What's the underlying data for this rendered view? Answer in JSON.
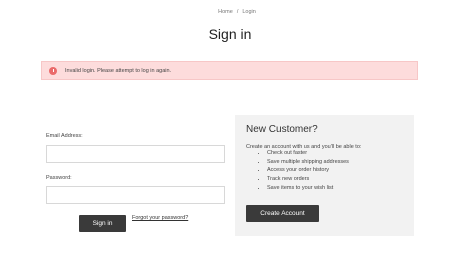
{
  "breadcrumb": {
    "home": "Home",
    "separator": "/",
    "current": "Login"
  },
  "page_title": "Sign in",
  "alert": {
    "message": "Invalid login. Please attempt to log in again."
  },
  "login_form": {
    "email_label": "Email Address:",
    "email_value": "",
    "password_label": "Password:",
    "password_value": "",
    "sign_in_label": "Sign in",
    "forgot_label": "Forgot your password?"
  },
  "new_customer": {
    "heading": "New Customer?",
    "intro": "Create an account with us and you'll be able to:",
    "benefits": [
      "Check out faster",
      "Save multiple shipping addresses",
      "Access your order history",
      "Track new orders",
      "Save items to your wish list"
    ],
    "create_label": "Create Account"
  },
  "colors": {
    "alert_bg": "#fddcdc",
    "alert_icon": "#ea6b6b",
    "button": "#3a3a3a",
    "panel": "#f2f2f2"
  }
}
